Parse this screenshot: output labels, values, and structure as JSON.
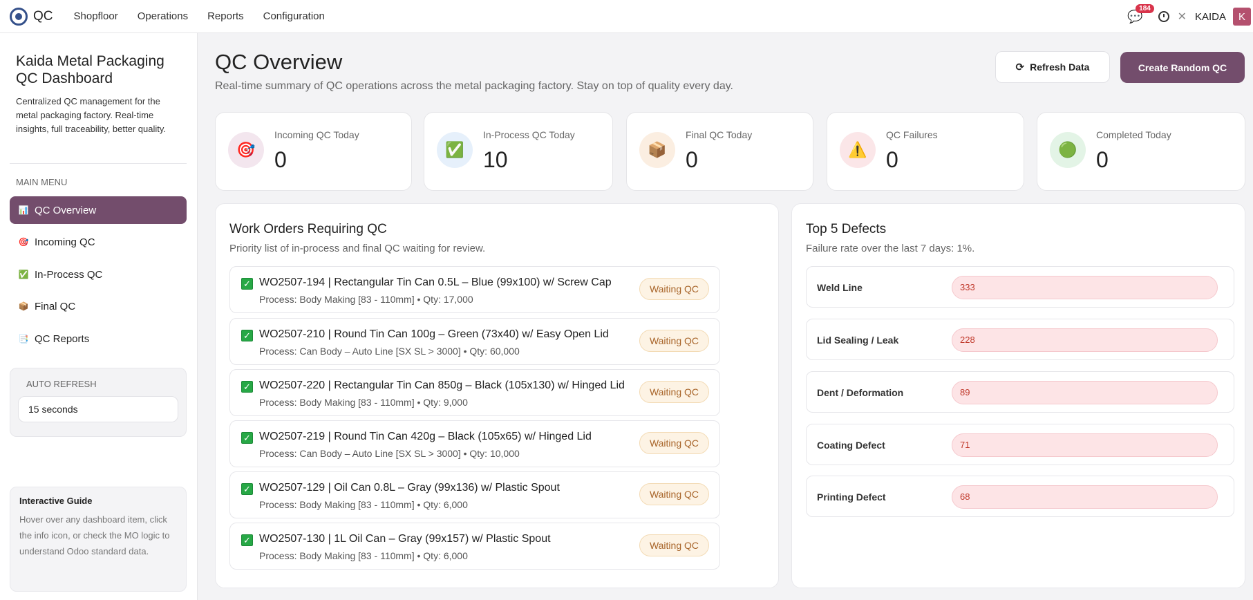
{
  "app": {
    "title": "QC",
    "user": "KAIDA",
    "avatar_letter": "K",
    "notification_count": "184"
  },
  "nav": [
    {
      "label": "Shopfloor"
    },
    {
      "label": "Operations"
    },
    {
      "label": "Reports"
    },
    {
      "label": "Configuration"
    }
  ],
  "sidebar": {
    "title": "Kaida Metal Packaging QC Dashboard",
    "description": "Centralized QC management for the metal packaging factory. Real-time insights, full traceability, better quality.",
    "menu_label": "MAIN MENU",
    "items": [
      {
        "label": "QC Overview",
        "icon": "chart-icon",
        "glyph": "📊"
      },
      {
        "label": "Incoming QC",
        "icon": "target-icon",
        "glyph": "🎯"
      },
      {
        "label": "In-Process QC",
        "icon": "check-icon",
        "glyph": "✅"
      },
      {
        "label": "Final QC",
        "icon": "box-icon",
        "glyph": "📦"
      },
      {
        "label": "QC Reports",
        "icon": "report-icon",
        "glyph": "📑"
      }
    ],
    "auto_refresh_label": "AUTO REFRESH",
    "auto_refresh_value": "15 seconds",
    "guide_title": "Interactive Guide",
    "guide_text": "Hover over any dashboard item, click the info icon, or check the MO logic to understand Odoo standard data."
  },
  "header": {
    "title": "QC Overview",
    "subtitle": "Real-time summary of QC operations across the metal packaging factory. Stay on top of quality every day.",
    "refresh_label": "Refresh Data",
    "create_label": "Create Random QC"
  },
  "stats": [
    {
      "label": "Incoming QC Today",
      "value": "0",
      "icon": "target-icon",
      "glyph": "🎯",
      "bg": "#f3e6ee"
    },
    {
      "label": "In-Process QC Today",
      "value": "10",
      "icon": "check-icon",
      "glyph": "✅",
      "bg": "#e6f0fb"
    },
    {
      "label": "Final QC Today",
      "value": "0",
      "icon": "box-icon",
      "glyph": "📦",
      "bg": "#fbeee1"
    },
    {
      "label": "QC Failures",
      "value": "0",
      "icon": "warning-icon",
      "glyph": "⚠️",
      "bg": "#fbe6e8"
    },
    {
      "label": "Completed Today",
      "value": "0",
      "icon": "status-icon",
      "glyph": "🟢",
      "bg": "#e3f4e6"
    }
  ],
  "work_orders": {
    "title": "Work Orders Requiring QC",
    "subtitle": "Priority list of in-process and final QC waiting for review.",
    "items": [
      {
        "title": "WO2507-194 | Rectangular Tin Can 0.5L – Blue (99x100) w/ Screw Cap",
        "process": "Process: Body Making [83 - 110mm]  • Qty:  17,000",
        "status": "Waiting QC"
      },
      {
        "title": "WO2507-210 | Round Tin Can 100g – Green (73x40) w/ Easy Open Lid",
        "process": "Process: Can Body – Auto Line [SX SL > 3000]  • Qty:  60,000",
        "status": "Waiting QC"
      },
      {
        "title": "WO2507-220 | Rectangular Tin Can 850g – Black (105x130) w/ Hinged Lid",
        "process": "Process: Body Making [83 - 110mm]  • Qty:  9,000",
        "status": "Waiting QC"
      },
      {
        "title": "WO2507-219 | Round Tin Can 420g – Black (105x65) w/ Hinged Lid",
        "process": "Process: Can Body – Auto Line [SX SL > 3000]  • Qty:  10,000",
        "status": "Waiting QC"
      },
      {
        "title": "WO2507-129 | Oil Can 0.8L – Gray (99x136) w/ Plastic Spout",
        "process": "Process: Body Making [83 - 110mm]  • Qty:  6,000",
        "status": "Waiting QC"
      },
      {
        "title": "WO2507-130 | 1L Oil Can – Gray (99x157) w/ Plastic Spout",
        "process": "Process: Body Making [83 - 110mm]  • Qty:  6,000",
        "status": "Waiting QC"
      }
    ]
  },
  "defects": {
    "title": "Top 5 Defects",
    "subtitle": "Failure rate over the last 7 days: 1%.",
    "items": [
      {
        "name": "Weld Line",
        "count": "333"
      },
      {
        "name": "Lid Sealing / Leak",
        "count": "228"
      },
      {
        "name": "Dent / Deformation",
        "count": "89"
      },
      {
        "name": "Coating Defect",
        "count": "71"
      },
      {
        "name": "Printing Defect",
        "count": "68"
      }
    ]
  },
  "colors": {
    "accent": "#734d6c",
    "waiting": "#a8652a",
    "defect": "#c0392b"
  }
}
